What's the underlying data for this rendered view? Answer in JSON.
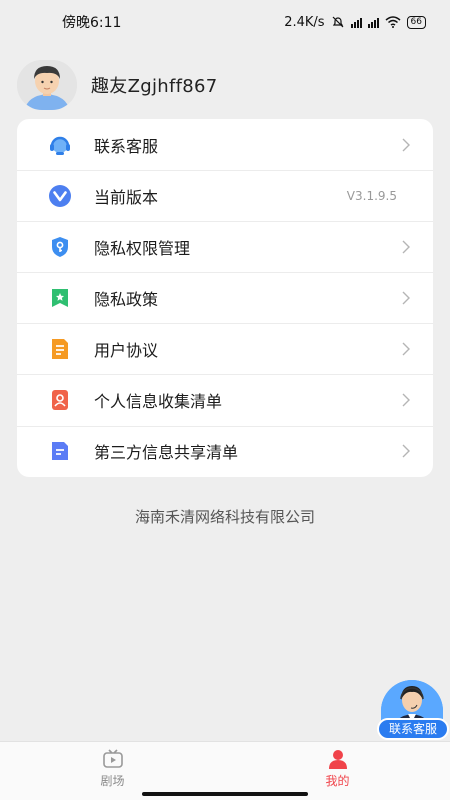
{
  "status_bar": {
    "time": "傍晚6:11",
    "network_speed": "2.4K/s",
    "battery": "66"
  },
  "profile": {
    "username": "趣友Zgjhff867"
  },
  "menu": {
    "items": [
      {
        "label": "联系客服",
        "icon": "headset-icon",
        "color": "#3b8cf2"
      },
      {
        "label": "当前版本",
        "value": "V3.1.9.5",
        "icon": "version-icon",
        "color": "#4a7cf0"
      },
      {
        "label": "隐私权限管理",
        "icon": "shield-key-icon",
        "color": "#3d8ef0"
      },
      {
        "label": "隐私政策",
        "icon": "bookmark-star-icon",
        "color": "#2fbf71"
      },
      {
        "label": "用户协议",
        "icon": "document-icon",
        "color": "#f59a23"
      },
      {
        "label": "个人信息收集清单",
        "icon": "person-card-icon",
        "color": "#f0634a"
      },
      {
        "label": "第三方信息共享清单",
        "icon": "file-lines-icon",
        "color": "#5b7cf5"
      }
    ]
  },
  "company": "海南禾清网络科技有限公司",
  "float_service": {
    "label": "联系客服"
  },
  "tabbar": {
    "tabs": [
      {
        "label": "剧场",
        "icon": "tv-play-icon",
        "active": false
      },
      {
        "label": "我的",
        "icon": "person-icon",
        "active": true
      }
    ],
    "active_color": "#f0434a"
  }
}
